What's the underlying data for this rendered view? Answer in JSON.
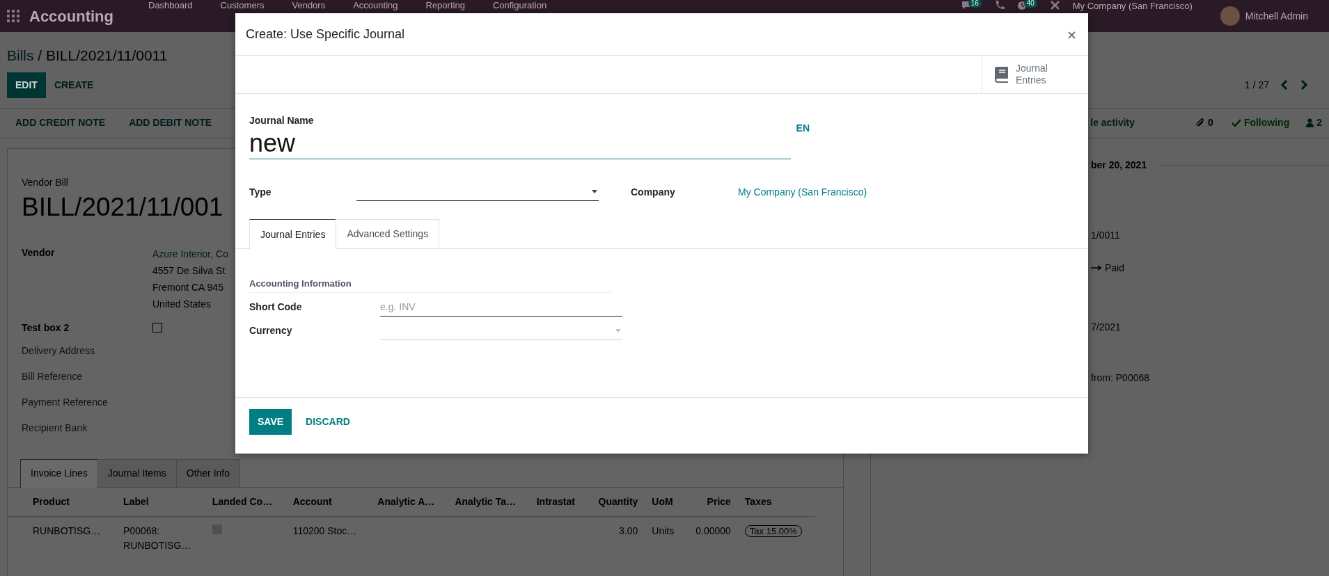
{
  "navbar": {
    "brand": "Accounting",
    "menu": [
      {
        "label": "Dashboard"
      },
      {
        "label": "Customers"
      },
      {
        "label": "Vendors"
      },
      {
        "label": "Accounting"
      },
      {
        "label": "Reporting"
      },
      {
        "label": "Configuration"
      }
    ],
    "systray": [
      {
        "kind": "chat",
        "badge": "16"
      },
      {
        "kind": "phone"
      },
      {
        "kind": "clock",
        "badge": "40"
      },
      {
        "kind": "tools"
      }
    ],
    "company": "My Company (San Francisco)",
    "user": "Mitchell Admin"
  },
  "breadcrumb": {
    "parent": "Bills",
    "separator": "/",
    "current": "BILL/2021/11/0011"
  },
  "buttons": [
    {
      "label": "EDIT",
      "primary": true
    },
    {
      "label": "CREATE",
      "primary": false
    }
  ],
  "pager": {
    "value": "1 / 27"
  },
  "actions": [
    "ADD CREDIT NOTE",
    "ADD DEBIT NOTE"
  ],
  "chatter_topbar": {
    "activity": "le activity",
    "attachments": "0",
    "follow": "Following",
    "followers": "2"
  },
  "sheet": {
    "title_label": "Vendor Bill",
    "name": "BILL/2021/11/001",
    "fields": [
      {
        "kind": "address",
        "label": "Vendor",
        "lines": [
          "Azure Interior, Co",
          "4557 De Silva St",
          "Fremont CA 945",
          "United States"
        ]
      },
      {
        "kind": "checkbox",
        "label": "Test box 2",
        "checked": false
      },
      {
        "kind": "empty",
        "label": "Delivery Address"
      },
      {
        "kind": "empty",
        "label": "Bill Reference"
      },
      {
        "kind": "empty",
        "label": "Payment Reference"
      },
      {
        "kind": "empty",
        "label": "Recipient Bank"
      }
    ]
  },
  "tabs": [
    {
      "label": "Invoice Lines",
      "selected": true
    },
    {
      "label": "Journal Items",
      "selected": false
    },
    {
      "label": "Other Info",
      "selected": false
    }
  ],
  "table": {
    "columns": [
      "Product",
      "Label",
      "Landed Co…",
      "Account",
      "Analytic A…",
      "Analytic Ta…",
      "Intrastat",
      "Quantity",
      "UoM",
      "Price",
      "Taxes"
    ],
    "rows": [
      {
        "product": "RUNBOTISG…",
        "label": [
          "P00068:",
          "RUNBOTISG…"
        ],
        "landed_costs": false,
        "account": "110200 Stoc…",
        "quantity": "3.00",
        "uom": "Units",
        "price": "0.00000",
        "taxes": [
          "Tax 15.00%"
        ]
      }
    ]
  },
  "chatter": {
    "date": "ber 20, 2021",
    "messages": [
      {
        "kind": "text",
        "text": "1/0011"
      },
      {
        "kind": "change",
        "text": "Paid"
      },
      {
        "kind": "text",
        "text": "7/2021"
      },
      {
        "kind": "text",
        "text": "from: P00068"
      }
    ]
  },
  "dialog": {
    "title": "Create: Use Specific Journal",
    "stat_buttons": [
      {
        "label": "Journal Entries"
      }
    ],
    "name_label": "Journal Name",
    "name_value": "new",
    "lang": "EN",
    "top_fields": [
      {
        "kind": "select",
        "label": "Type",
        "required": true
      },
      {
        "kind": "link",
        "label": "Company",
        "value": "My Company (San Francisco)"
      }
    ],
    "tabs": [
      {
        "label": "Journal Entries",
        "selected": true
      },
      {
        "label": "Advanced Settings",
        "selected": false
      }
    ],
    "group_title": "Accounting Information",
    "fields": [
      {
        "kind": "input",
        "label": "Short Code",
        "placeholder": "e.g. INV",
        "required": true
      },
      {
        "kind": "select",
        "label": "Currency",
        "required": false
      }
    ],
    "footer_buttons": [
      {
        "label": "SAVE",
        "primary": true
      },
      {
        "label": "DISCARD",
        "primary": false
      }
    ]
  }
}
